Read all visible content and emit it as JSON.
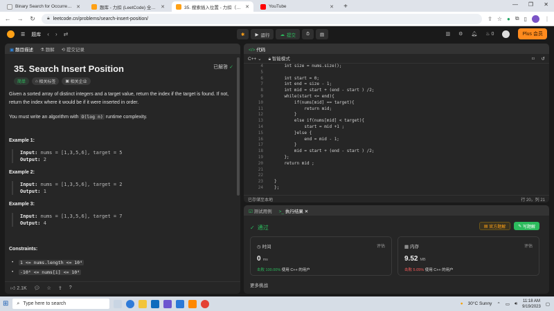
{
  "browser": {
    "tabs": [
      {
        "title": "Binary Search for Occurrences",
        "color": "#e8eaed",
        "active": false
      },
      {
        "title": "题库 - 力扣 (LeetCode) 全球极客",
        "color": "#ffa116",
        "active": false
      },
      {
        "title": "35. 搜索插入位置 - 力扣（LeetCode）",
        "color": "#ffa116",
        "active": true
      },
      {
        "title": "YouTube",
        "color": "#ff0000",
        "active": false
      }
    ],
    "url": "leetcode.cn/problems/search-insert-position/"
  },
  "lcnav": {
    "problems": "题库",
    "run": "运行",
    "submit": "提交",
    "fire_count": "0",
    "plus": "Plus 会员"
  },
  "problem_panel": {
    "tabs": [
      "题目描述",
      "题解",
      "提交记录"
    ],
    "title": "35. Search Insert Position",
    "status": "已解答",
    "tags": [
      "简单",
      "相关标签",
      "相关企业"
    ],
    "desc1": "Given a sorted array of distinct integers and a target value, return the index if the target is found. If not, return the index where it would be if it were inserted in order.",
    "desc2_pre": "You must write an algorithm with",
    "desc2_code": "O(log n)",
    "desc2_post": "runtime complexity.",
    "examples": [
      {
        "heading": "Example 1:",
        "input": "nums = [1,3,5,6], target = 5",
        "output": "2"
      },
      {
        "heading": "Example 2:",
        "input": "nums = [1,3,5,6], target = 2",
        "output": "1"
      },
      {
        "heading": "Example 3:",
        "input": "nums = [1,3,5,6], target = 7",
        "output": "4"
      }
    ],
    "input_label": "Input:",
    "output_label": "Output:",
    "constraints_heading": "Constraints:",
    "constraints": [
      "1 <= nums.length <= 10⁴",
      "-10⁴ <= nums[i] <= 10⁴"
    ],
    "likes": "2.1K"
  },
  "code_panel": {
    "title": "代码",
    "language": "C++",
    "mode": "智能模式",
    "line_numbers": [
      "4",
      "5",
      "6",
      "7",
      "8",
      "9",
      "10",
      "11",
      "12",
      "13",
      "14",
      "15",
      "16",
      "17",
      "18",
      "19",
      "20",
      "21",
      "22",
      "23",
      "24"
    ],
    "lines": [
      "    int size = nums.size();",
      "",
      "    int start = 0;",
      "    int end = size - 1;",
      "    int mid = start + (end - start ) /2;",
      "    while(start <= end){",
      "        if(nums[mid] == target){",
      "            return mid;",
      "        }",
      "        else if(nums[mid] < target){",
      "            start = mid +1 ;",
      "        }else {",
      "            end = mid - 1;",
      "        }",
      "        mid = start + (end - start ) /2;",
      "    };",
      "    return mid ;",
      "",
      "",
      "}",
      "};"
    ],
    "saved": "已存储至本地",
    "cursor": "行 20，列 21"
  },
  "result_panel": {
    "tabs": [
      "测试用例",
      "执行结果"
    ],
    "status": "通过",
    "official_button": "官方题解",
    "write_button": "写题解",
    "time_label": "时间",
    "time_value": "0",
    "time_unit": "ms",
    "time_beat_pct": "100.00%",
    "memory_label": "内存",
    "memory_value": "9.52",
    "memory_unit": "MB",
    "memory_beat_pct": "5.05%",
    "beat_prefix": "击败",
    "beat_suffix": "使用 C++ 的用户",
    "analysis": "评估",
    "more": "更多挑战"
  },
  "taskbar": {
    "search_placeholder": "Type here to search",
    "weather": "30°C  Sunny",
    "time": "11:18 AM",
    "date": "9/19/2023"
  },
  "colors": {
    "accent_green": "#2cbb5d",
    "accent_orange": "#ffa116",
    "memory_red": "#ff5c5c"
  }
}
